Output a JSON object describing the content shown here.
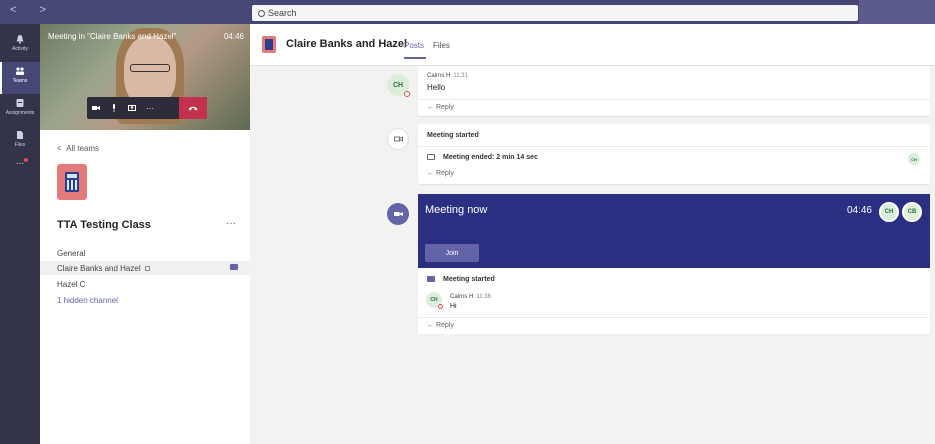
{
  "topbar": {
    "nav_arrows": "< >",
    "search_placeholder": "Search"
  },
  "rail": {
    "items": [
      {
        "label": "Activity"
      },
      {
        "label": "Teams"
      },
      {
        "label": "Assignments"
      },
      {
        "label": "Files"
      },
      {
        "label": "..."
      }
    ]
  },
  "call": {
    "title": "Meeting in \"Claire Banks and Hazel\"",
    "time": "04:46"
  },
  "team": {
    "all_teams": "All teams",
    "name": "TTA Testing Class",
    "more": "···",
    "channels": [
      "General",
      "Claire Banks and Hazel",
      "Hazel C"
    ],
    "hidden": "1 hidden channel"
  },
  "header": {
    "title": "Claire Banks and Hazel",
    "tabs": [
      "Posts",
      "Files"
    ]
  },
  "feed": {
    "post1": {
      "avatar": "CH",
      "author": "Cairns H",
      "time": "11:31",
      "text": "Hello",
      "reply": "← Reply"
    },
    "meeting1": {
      "started": "Meeting started",
      "ended": "Meeting ended: 2 min 14 sec",
      "participant": "CH",
      "reply": "← Reply"
    },
    "meeting_now": {
      "title": "Meeting now",
      "time": "04:46",
      "participants": [
        "CH",
        "CB"
      ],
      "join": "Join"
    },
    "thread": {
      "started": "Meeting started",
      "avatar": "CH",
      "author": "Cairns H",
      "time": "11:36",
      "text": "Hi",
      "reply": "← Reply"
    }
  },
  "colors": {
    "brand": "#464775",
    "accent": "#6264a7",
    "meeting_banner": "#2b2f82",
    "hangup": "#c4314b"
  }
}
